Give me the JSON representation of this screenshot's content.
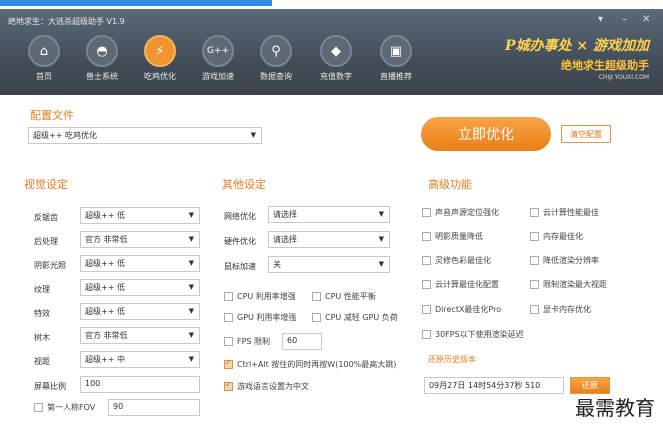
{
  "window": {
    "title": "绝地求生：大逃杀超级助手 V1.9",
    "dropdown_glyph": "▾",
    "minimize_glyph": "–"
  },
  "nav": [
    {
      "label": "首页",
      "icon": "home-icon"
    },
    {
      "label": "兽士系统",
      "icon": "helmet-icon"
    },
    {
      "label": "吃鸡优化",
      "icon": "chicken-icon"
    },
    {
      "label": "游戏加速",
      "icon": "gamepad-icon"
    },
    {
      "label": "数据查询",
      "icon": "search-icon"
    },
    {
      "label": "充值数字",
      "icon": "diamond-icon"
    },
    {
      "label": "直播推荐",
      "icon": "tv-icon"
    }
  ],
  "brand": {
    "line1": "P城办事处 × 游戏加加",
    "line2": "绝地求生超级助手",
    "line3": "CHIJI.YOUXI.COM"
  },
  "config": {
    "title": "配置文件",
    "selected": "超级++ 吃鸡优化",
    "apply_button": "立即优化",
    "clear_button": "清空配置"
  },
  "video": {
    "title": "视觉设定",
    "rows": [
      {
        "label": "反锯齿",
        "value": "超级++ 低"
      },
      {
        "label": "后处理",
        "value": "官方 非常低"
      },
      {
        "label": "阴影光照",
        "value": "超级++ 低"
      },
      {
        "label": "纹理",
        "value": "超级++ 低"
      },
      {
        "label": "特效",
        "value": "超级++ 低"
      },
      {
        "label": "树木",
        "value": "官方 非常低"
      },
      {
        "label": "视距",
        "value": "超级++ 中"
      }
    ],
    "ratio_label": "屏幕比例",
    "ratio_value": "100",
    "fov_label": "第一人称FOV",
    "fov_value": "90"
  },
  "other": {
    "title": "其他设定",
    "rows": [
      {
        "label": "网络优化",
        "value": "请选择"
      },
      {
        "label": "硬件优化",
        "value": "请选择"
      },
      {
        "label": "鼠标加速",
        "value": "关"
      }
    ],
    "checks": [
      {
        "label": "CPU 利用率增强",
        "checked": false
      },
      {
        "label": "CPU 性能平衡",
        "checked": false
      },
      {
        "label": "GPU 利用率增强",
        "checked": false
      },
      {
        "label": "CPU 减轻 GPU 负荷",
        "checked": false
      }
    ],
    "fps_label": "FPS 限制",
    "fps_value": "60",
    "ctrl_alt": "Ctrl+Alt 按住的同时再按W(100%最高大跳)",
    "lang": "游戏语言设置为中文"
  },
  "advanced": {
    "title": "高级功能",
    "checks": [
      {
        "label": "声音声源定位强化"
      },
      {
        "label": "云计算性能最佳"
      },
      {
        "label": "明影质量降低"
      },
      {
        "label": "内存最佳化"
      },
      {
        "label": "灵修色彩最佳化"
      },
      {
        "label": "降低渲染分辨率"
      },
      {
        "label": "云计算最佳化配置"
      },
      {
        "label": "限制渲染最大视距"
      },
      {
        "label": "DirectX最佳化Pro"
      },
      {
        "label": "显卡内存优化"
      },
      {
        "label": "30FPS以下使用渲染延迟"
      }
    ],
    "restore_title": "还原历史版本",
    "restore_value": "09月27日 14时54分37秒 510",
    "restore_button": "还原"
  },
  "watermark": "最需教育"
}
